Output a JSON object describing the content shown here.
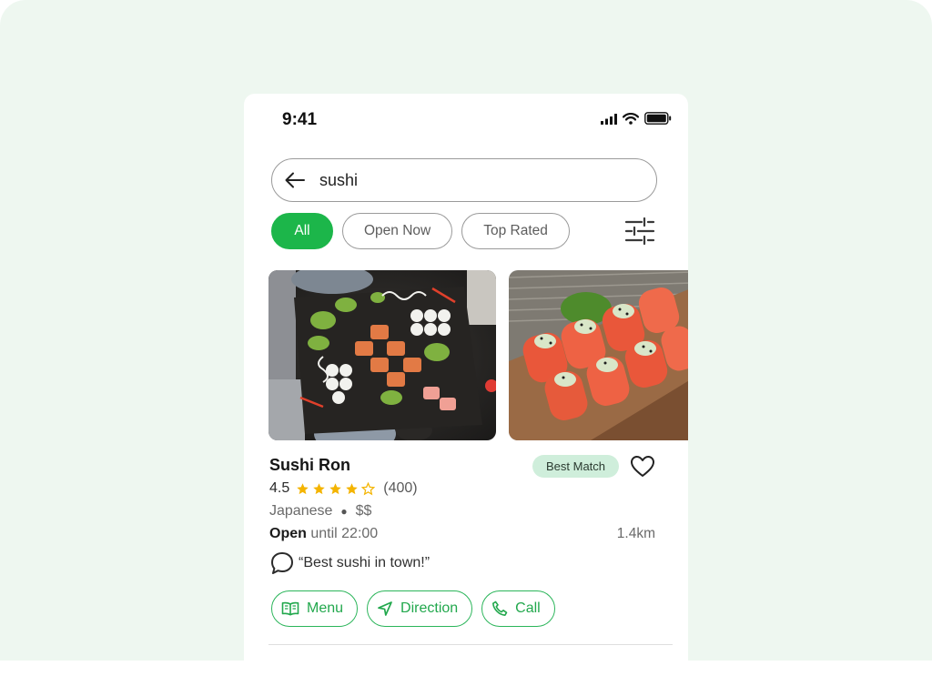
{
  "status_bar": {
    "time": "9:41",
    "icons": [
      "signal-icon",
      "wifi-icon",
      "battery-icon"
    ]
  },
  "search": {
    "value": "sushi",
    "back_icon": "arrow-left-icon"
  },
  "filters": {
    "chips": [
      "All",
      "Open Now",
      "Top Rated"
    ],
    "active": "All",
    "filter_icon": "sliders-icon"
  },
  "restaurant": {
    "name": "Sushi Ron",
    "badge": "Best Match",
    "rating": "4.5",
    "stars_filled": 4,
    "stars_total": 5,
    "reviews": "(400)",
    "cuisine": "Japanese",
    "price": "$$",
    "open_label": "Open",
    "open_until": "until 22:00",
    "distance": "1.4km",
    "review_quote": "“Best sushi in town!”",
    "photos": [
      "sushi-platter-photo",
      "salmon-rolls-photo"
    ]
  },
  "actions": {
    "menu": "Menu",
    "direction": "Direction",
    "call": "Call"
  },
  "colors": {
    "accent": "#1cb64a",
    "badge_bg": "#cfeedb",
    "star": "#f4b400",
    "backdrop": "#eef7f0"
  }
}
